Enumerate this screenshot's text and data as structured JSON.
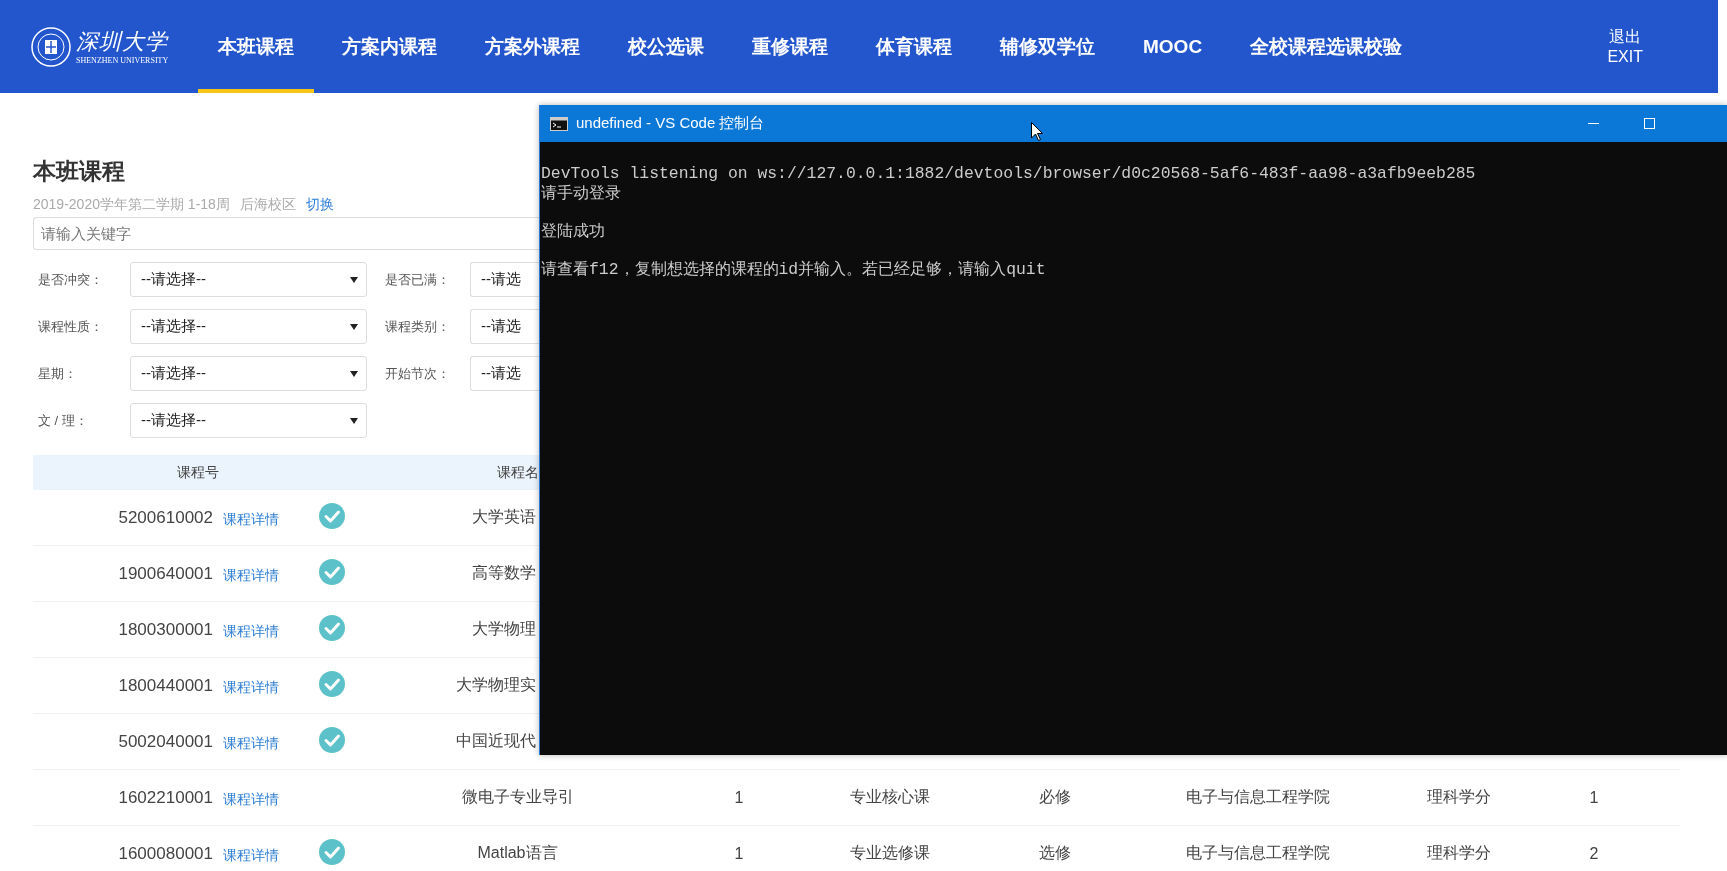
{
  "header": {
    "logo": {
      "name": "深圳大学",
      "subtitle": "SHENZHEN UNIVERSITY"
    },
    "nav": [
      {
        "label": "本班课程",
        "selected": true
      },
      {
        "label": "方案内课程",
        "selected": false
      },
      {
        "label": "方案外课程",
        "selected": false
      },
      {
        "label": "校公选课",
        "selected": false
      },
      {
        "label": "重修课程",
        "selected": false
      },
      {
        "label": "体育课程",
        "selected": false
      },
      {
        "label": "辅修双学位",
        "selected": false
      },
      {
        "label": "MOOC",
        "selected": false
      },
      {
        "label": "全校课程选课校验",
        "selected": false
      }
    ],
    "logout": {
      "label": "退出",
      "sublabel": "EXIT"
    }
  },
  "page": {
    "title": "本班课程",
    "term": "2019-2020学年第二学期 1-18周",
    "campus": "后海校区",
    "switch_link": "切换",
    "search": {
      "placeholder": "请输入关键字"
    },
    "filters": [
      {
        "label": "是否冲突：",
        "value": "--请选择--",
        "kind": "full"
      },
      {
        "label": "是否已满：",
        "value": "--请选",
        "kind": "cut"
      },
      {
        "label": "课程性质：",
        "value": "--请选择--",
        "kind": "full"
      },
      {
        "label": "课程类别：",
        "value": "--请选",
        "kind": "cut"
      },
      {
        "label": "星期：",
        "value": "--请选择--",
        "kind": "full"
      },
      {
        "label": "开始节次：",
        "value": "--请选",
        "kind": "cut"
      },
      {
        "label": "文 / 理：",
        "value": "--请选择--",
        "kind": "full"
      }
    ]
  },
  "table": {
    "columns": [
      "课程号",
      "课程名"
    ],
    "rows": [
      {
        "code": "5200610002",
        "detail": "课程详情",
        "checked": true,
        "name": "大学英语"
      },
      {
        "code": "1900640001",
        "detail": "课程详情",
        "checked": true,
        "name": "高等数学"
      },
      {
        "code": "1800300001",
        "detail": "课程详情",
        "checked": true,
        "name": "大学物理"
      },
      {
        "code": "1800440001",
        "detail": "课程详情",
        "checked": true,
        "name": "大学物理实"
      },
      {
        "code": "5002040001",
        "detail": "课程详情",
        "checked": true,
        "name": "中国近现代"
      },
      {
        "code": "1602210001",
        "detail": "课程详情",
        "checked": false,
        "name": "微电子专业导引",
        "credit": "1",
        "type": "专业核心课",
        "requirement": "必修",
        "college": "电子与信息工程学院",
        "credit_type": "理科学分",
        "column_8": "1"
      },
      {
        "code": "1600080001",
        "detail": "课程详情",
        "checked": true,
        "name": "Matlab语言",
        "credit": "1",
        "type": "专业选修课",
        "requirement": "选修",
        "college": "电子与信息工程学院",
        "credit_type": "理科学分",
        "column_8": "2"
      }
    ]
  },
  "console": {
    "title": "undefined - VS Code 控制台",
    "blocks": [
      [
        "DevTools listening on ws://127.0.0.1:1882/devtools/browser/d0c20568-5af6-483f-aa98-a3afb9eeb285",
        "请手动登录"
      ],
      [
        "登陆成功"
      ],
      [
        "请查看f12，复制想选择的课程的id并输入。若已经足够，请输入quit"
      ]
    ]
  }
}
